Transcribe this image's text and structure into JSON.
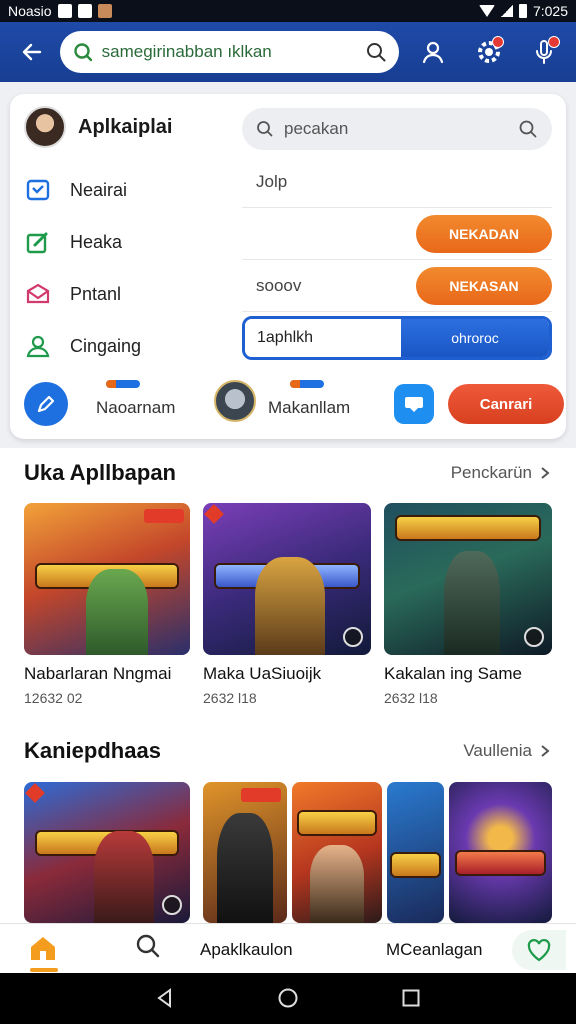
{
  "status_bar": {
    "left_text": "Noasio",
    "time": "7:025"
  },
  "app_bar": {
    "search_text": "samegirinabban ıklkan"
  },
  "profile": {
    "name": "Aplkaiplai",
    "search_placeholder": "pecakan"
  },
  "menu": [
    {
      "label": "Neairai",
      "icon": "folder-icon",
      "color": "#1e6fe0"
    },
    {
      "label": "Heaka",
      "icon": "edit-icon",
      "color": "#1f9a4a"
    },
    {
      "label": "Pntanl",
      "icon": "mail-icon",
      "color": "#d23a6e"
    },
    {
      "label": "Cingaing",
      "icon": "user-icon",
      "color": "#1f9a4a"
    }
  ],
  "fields": [
    {
      "text": "Jolp",
      "button": ""
    },
    {
      "text": "",
      "button": "NEKADAN"
    },
    {
      "text": "sooov",
      "button": "NEKASAN"
    }
  ],
  "active_field": {
    "value": "1aphlkh",
    "button": "ohroroc"
  },
  "actions": {
    "left_label": "Naoarnam",
    "mid_label": "Makanllam",
    "button": "Canrari"
  },
  "section1": {
    "title": "Uka Apllbapan",
    "link": "Penckarün",
    "games": [
      {
        "name": "Nabarlaran Nngmai",
        "meta": "12632 02"
      },
      {
        "name": "Maka UaSiuoijk",
        "meta": "2632 l18"
      },
      {
        "name": "Kakalan ing Same",
        "meta": "2632 l18"
      }
    ]
  },
  "section2": {
    "title": "Kaniepdhaas",
    "link": "Vaullenia"
  },
  "bottom_nav": {
    "mid_text": "Apaklkaulon",
    "right_text": "MCeanlagan"
  },
  "colors": {
    "app_bar": "#1f4aa8",
    "orange": "#e8681a",
    "blue": "#1e6fe0",
    "red": "#d8401f"
  }
}
